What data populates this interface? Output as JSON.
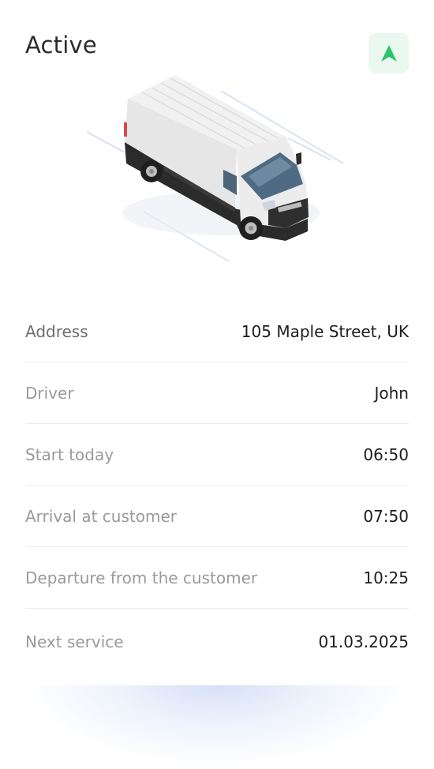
{
  "header": {
    "title": "Active",
    "nav_icon": "navigation-arrow-icon",
    "accent_color": "#2cc36b"
  },
  "vehicle": {
    "image": "white-van-illustration"
  },
  "details": [
    {
      "label": "Address",
      "value": "105 Maple Street, UK"
    },
    {
      "label": "Driver",
      "value": "John"
    },
    {
      "label": "Start today",
      "value": "06:50"
    },
    {
      "label": "Arrival at customer",
      "value": "07:50"
    },
    {
      "label": "Departure from the customer",
      "value": "10:25"
    },
    {
      "label": "Next service",
      "value": "01.03.2025"
    }
  ]
}
